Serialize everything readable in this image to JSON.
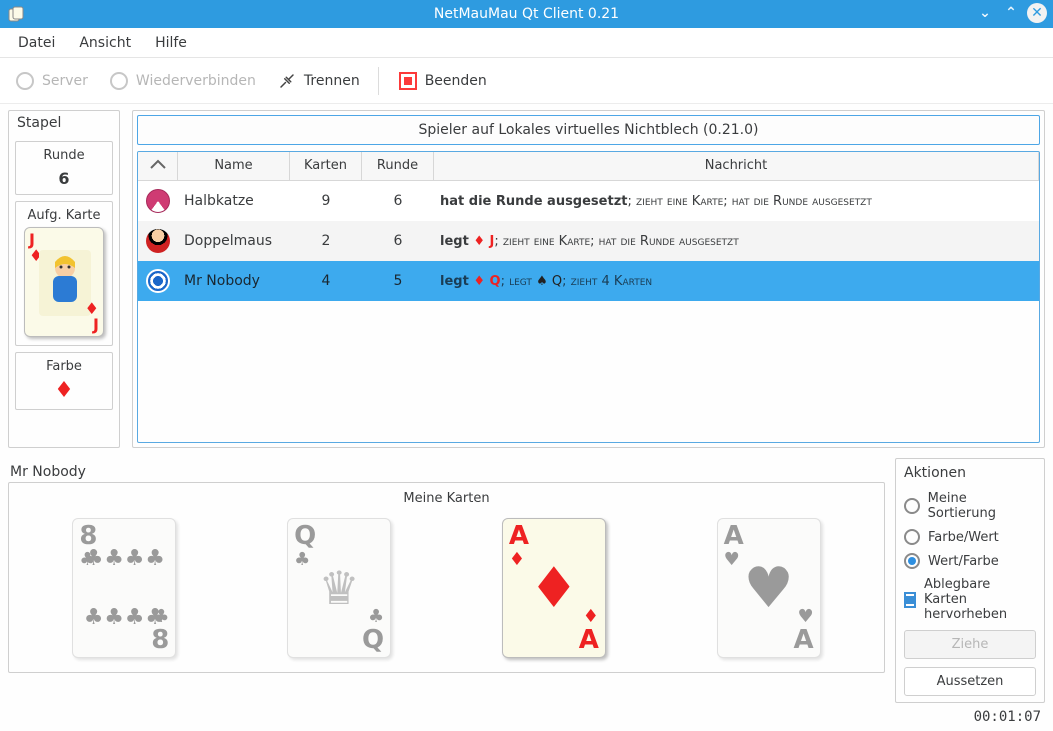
{
  "window": {
    "title": "NetMauMau Qt Client 0.21"
  },
  "menu": {
    "file": "Datei",
    "view": "Ansicht",
    "help": "Hilfe"
  },
  "toolbar": {
    "server": "Server",
    "reconnect": "Wiederverbinden",
    "disconnect": "Trennen",
    "quit": "Beenden"
  },
  "stapel": {
    "header": "Stapel",
    "round_label": "Runde",
    "round_value": "6",
    "open_label": "Aufg. Karte",
    "open_rank": "J",
    "open_suit": "♦",
    "open_color": "red",
    "color_label": "Farbe",
    "color_suit": "♦"
  },
  "server": {
    "caption": "Spieler auf Lokales virtuelles Nichtblech (0.21.0)"
  },
  "table": {
    "headers": {
      "name": "Name",
      "cards": "Karten",
      "round": "Runde",
      "message": "Nachricht"
    },
    "rows": [
      {
        "avatar": "av0",
        "name": "Halbkatze",
        "cards": "9",
        "round": "6",
        "selected": false,
        "msg_html": "<b>hat die Runde ausgesetzt</b>; <span class='sc'>zieht eine Karte; hat die Runde ausgesetzt</span>"
      },
      {
        "avatar": "av1",
        "name": "Doppelmaus",
        "cards": "2",
        "round": "6",
        "selected": false,
        "msg_html": "<b>legt <span class='red'>♦ J</span></b>; <span class='sc'>zieht eine Karte; hat die Runde ausgesetzt</span>"
      },
      {
        "avatar": "av2",
        "name": "Mr Nobody",
        "cards": "4",
        "round": "5",
        "selected": true,
        "msg_html": "<b>legt <span class='red'>♦ Q</span></b>; <span class='sc'>legt <span class='blk'>♠ Q</span>; zieht 4 Karten</span>"
      }
    ]
  },
  "player": {
    "name": "Mr Nobody",
    "hand_title": "Meine Karten"
  },
  "hand": [
    {
      "rank": "8",
      "suit": "♣",
      "color": "blk",
      "playable": false,
      "kind": "pips8"
    },
    {
      "rank": "Q",
      "suit": "♣",
      "color": "blk",
      "playable": false,
      "kind": "queen"
    },
    {
      "rank": "A",
      "suit": "♦",
      "color": "red",
      "playable": true,
      "kind": "ace"
    },
    {
      "rank": "A",
      "suit": "♥",
      "color": "blk",
      "playable": false,
      "kind": "ace"
    }
  ],
  "actions": {
    "header": "Aktionen",
    "sort_mine": "Meine Sortierung",
    "sort_sv": "Farbe/Wert",
    "sort_vs": "Wert/Farbe",
    "highlight": "Ablegbare Karten hervorheben",
    "draw": "Ziehe",
    "skip": "Aussetzen",
    "selected_sort": "vs",
    "highlight_on": true
  },
  "timer": "00:01:07"
}
